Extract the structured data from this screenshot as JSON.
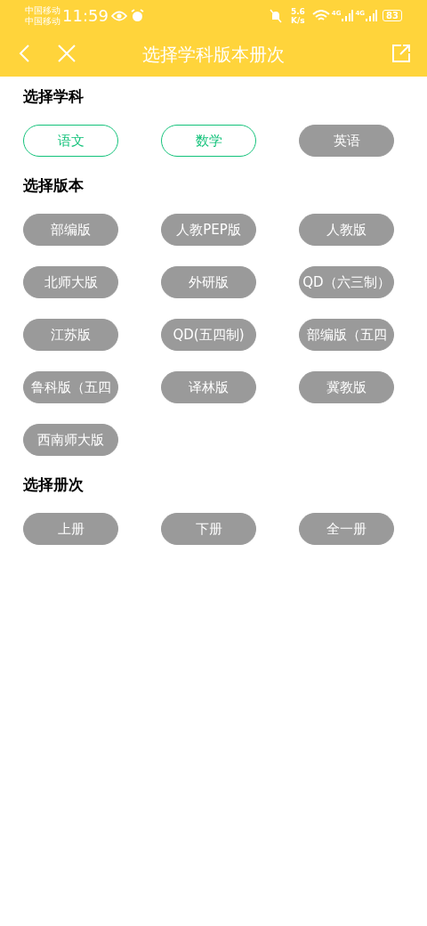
{
  "status_bar": {
    "carriers": [
      "中国移动",
      "中国移动"
    ],
    "time": "11:59",
    "speed": "5.6",
    "speed_unit": "K/s",
    "network_1": "4G",
    "network_2": "4G",
    "battery": "83"
  },
  "nav": {
    "title": "选择学科版本册次"
  },
  "sections": [
    {
      "heading": "选择学科",
      "options": [
        {
          "label": "语文",
          "selected": true
        },
        {
          "label": "数学",
          "selected": true
        },
        {
          "label": "英语",
          "selected": false
        }
      ]
    },
    {
      "heading": "选择版本",
      "options": [
        {
          "label": "部编版",
          "selected": false
        },
        {
          "label": "人教PEP版",
          "selected": false
        },
        {
          "label": "人教版",
          "selected": false
        },
        {
          "label": "北师大版",
          "selected": false
        },
        {
          "label": "外研版",
          "selected": false
        },
        {
          "label": "QD（六三制）",
          "selected": false
        },
        {
          "label": "江苏版",
          "selected": false
        },
        {
          "label": "QD(五四制)",
          "selected": false
        },
        {
          "label": "部编版（五四",
          "selected": false
        },
        {
          "label": "鲁科版（五四",
          "selected": false
        },
        {
          "label": "译林版",
          "selected": false
        },
        {
          "label": "冀教版",
          "selected": false
        },
        {
          "label": "西南师大版",
          "selected": false
        }
      ]
    },
    {
      "heading": "选择册次",
      "options": [
        {
          "label": "上册",
          "selected": false
        },
        {
          "label": "下册",
          "selected": false
        },
        {
          "label": "全一册",
          "selected": false
        }
      ]
    }
  ]
}
